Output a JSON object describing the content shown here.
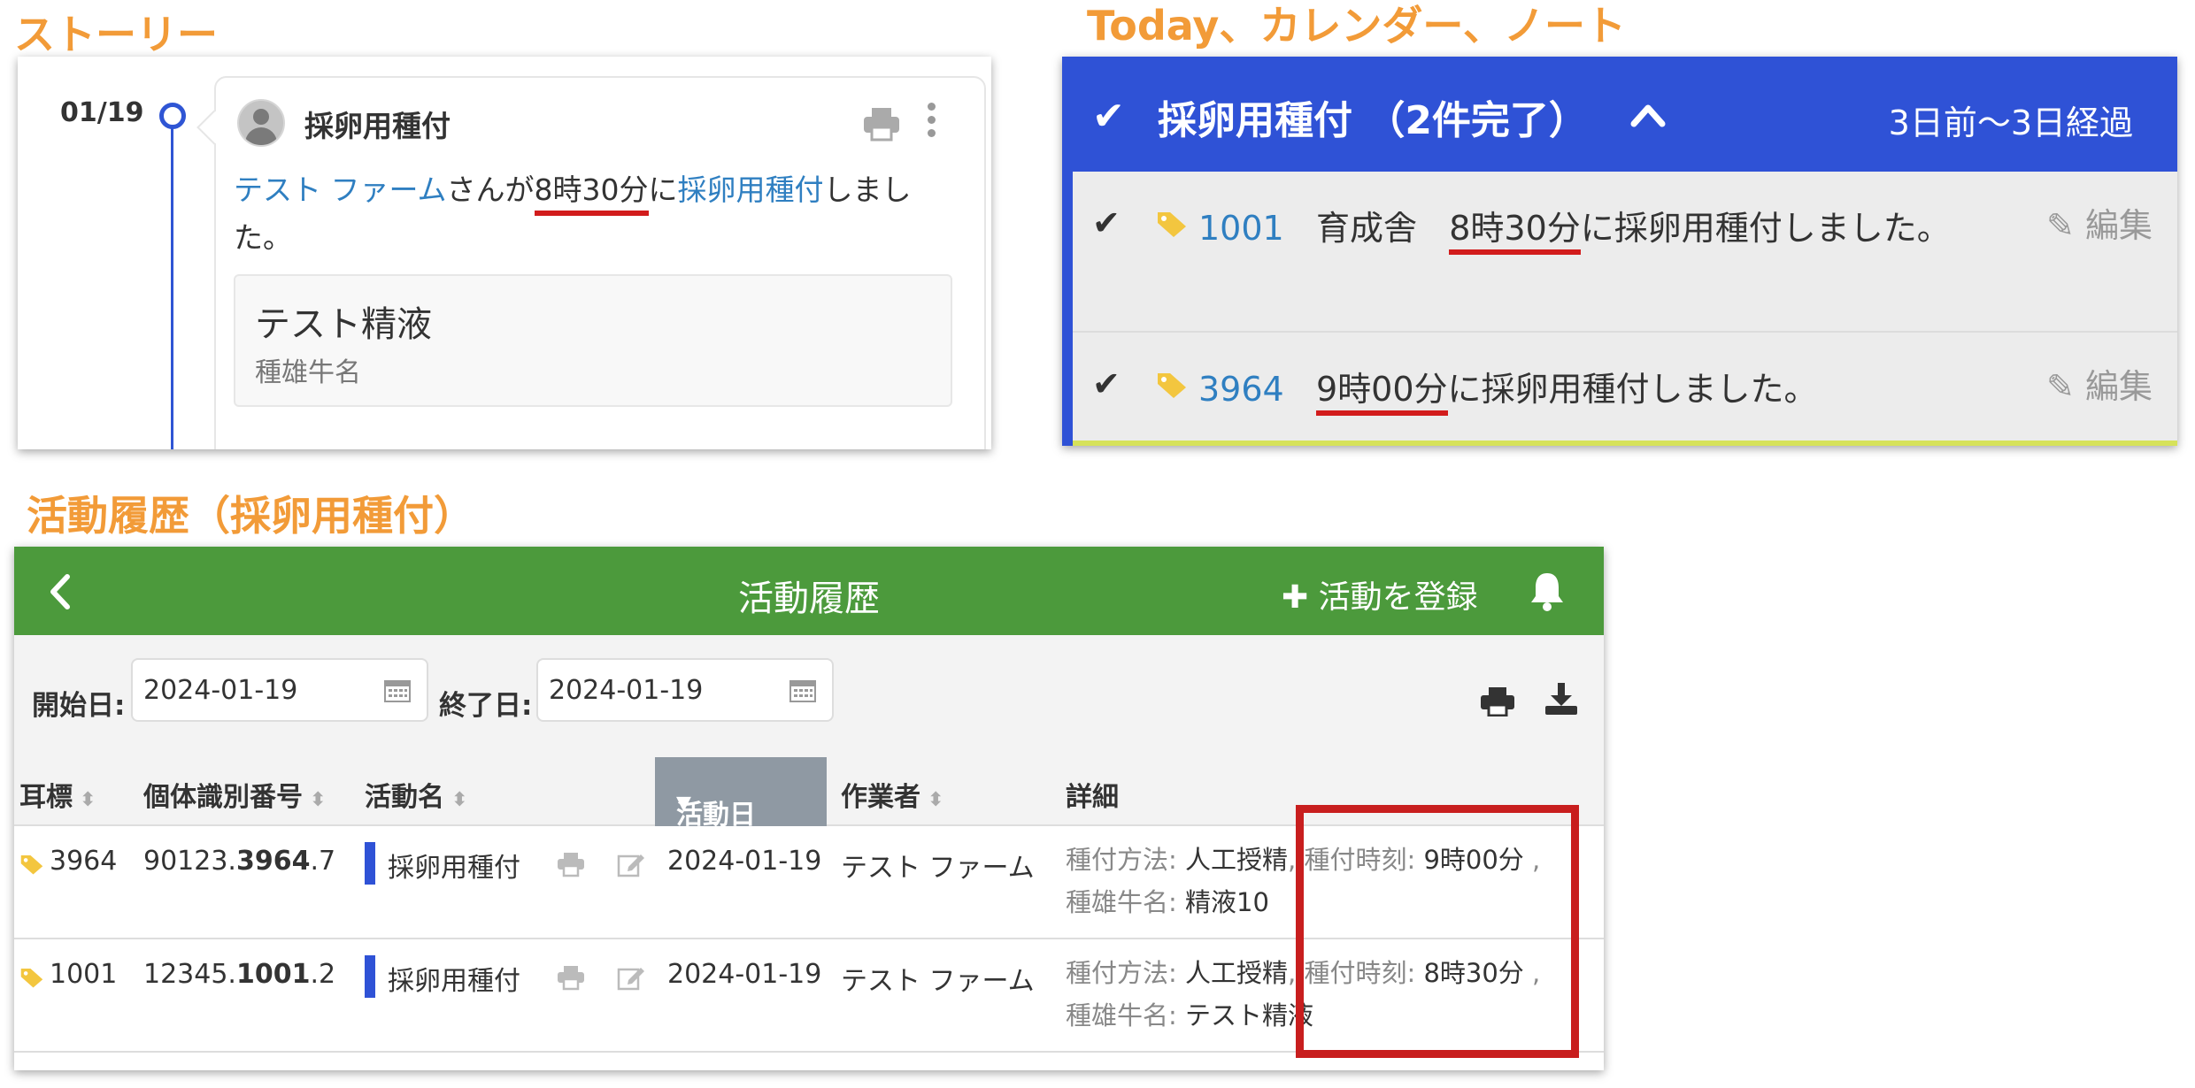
{
  "labels": {
    "story": "ストーリー",
    "today": "Today、カレンダー、ノート",
    "history": "活動履歴（採卵用種付）"
  },
  "story": {
    "date": "01/19",
    "title": "採卵用種付",
    "farm": "テスト ファーム",
    "text_san": "さんが",
    "time": "8時30分",
    "text_ni": "に",
    "activity": "採卵用種付",
    "text_end": "しました。",
    "semen_name": "テスト精液",
    "semen_label": "種雄牛名"
  },
  "today": {
    "header_title": "採卵用種付 （2件完了）",
    "elapsed": "3日前〜3日経過",
    "edit_label": "編集",
    "rows": [
      {
        "tag": "1001",
        "barn": "育成舎",
        "time": "8時30分",
        "text": "に採卵用種付しました。"
      },
      {
        "tag": "3964",
        "barn": "",
        "time": "9時00分",
        "text": "に採卵用種付しました。"
      }
    ]
  },
  "history": {
    "title": "活動履歴",
    "add_label": "活動を登録",
    "start_label": "開始日:",
    "start_value": "2024-01-19",
    "end_label": "終了日:",
    "end_value": "2024-01-19",
    "columns": {
      "ear_tag": "耳標",
      "id_number": "個体識別番号",
      "activity": "活動名",
      "date": "活動日",
      "worker": "作業者",
      "detail": "詳細"
    },
    "detail_keys": {
      "method": "種付方法:",
      "time": "種付時刻:",
      "bull": "種雄牛名:"
    },
    "rows": [
      {
        "ear_tag": "3964",
        "id_prefix": "90123.",
        "id_bold": "3964",
        "id_suffix": ".7",
        "activity": "採卵用種付",
        "date": "2024-01-19",
        "worker": "テスト ファーム",
        "method": "人工授精",
        "time": "9時00分",
        "bull": "精液10"
      },
      {
        "ear_tag": "1001",
        "id_prefix": "12345.",
        "id_bold": "1001",
        "id_suffix": ".2",
        "activity": "採卵用種付",
        "date": "2024-01-19",
        "worker": "テスト ファーム",
        "method": "人工授精",
        "time": "8時30分",
        "bull": "テスト精液"
      }
    ]
  },
  "colors": {
    "accent_orange": "#f29b38",
    "blue_header": "#2f52d6",
    "green_header": "#4c9a3c",
    "highlight_red": "#c81e1e"
  }
}
